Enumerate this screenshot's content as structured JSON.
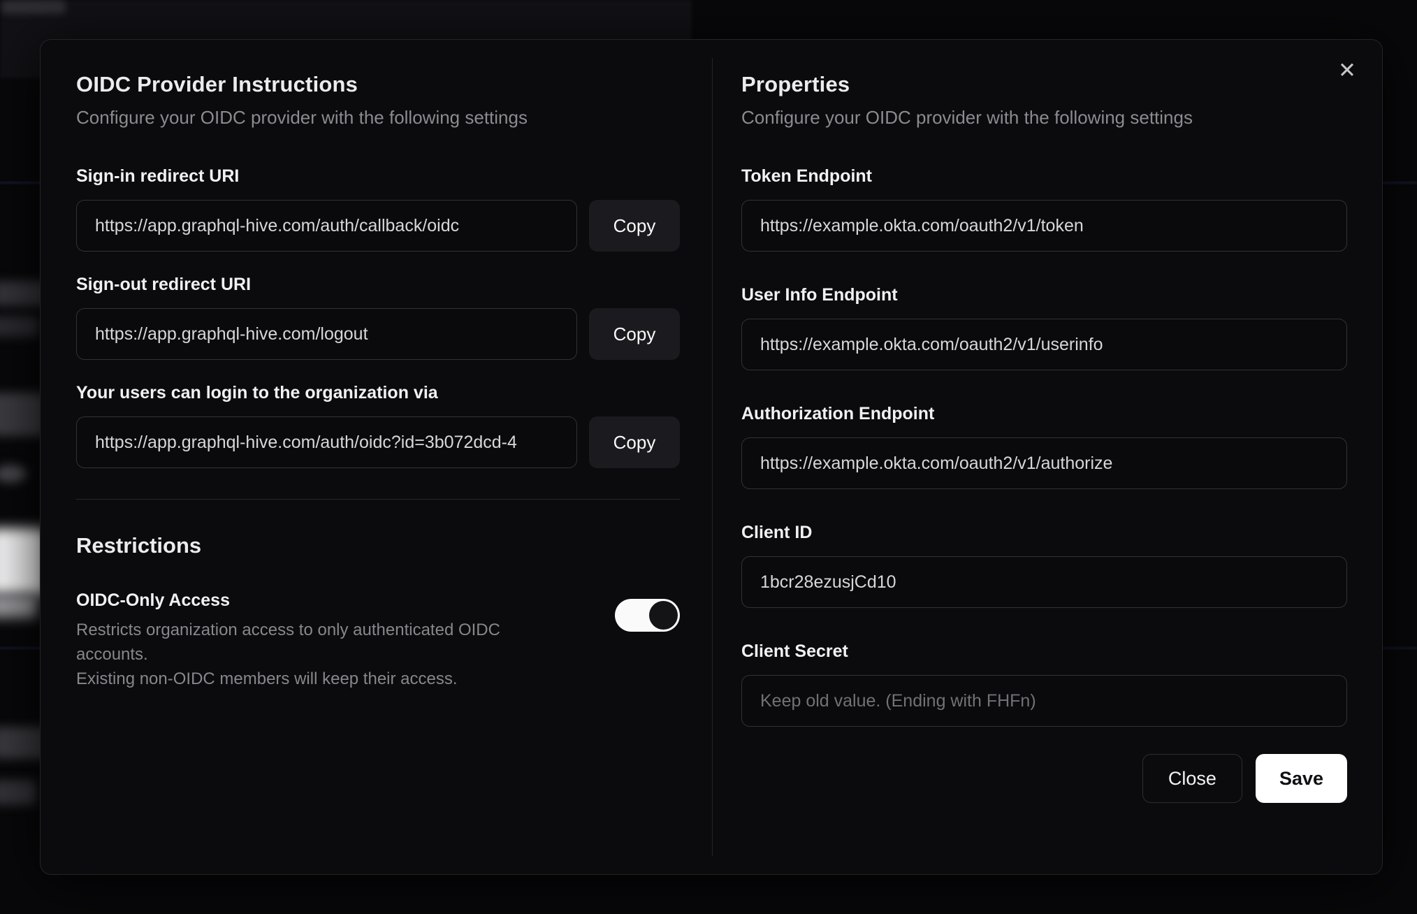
{
  "colors": {
    "page_bg": "#08080a",
    "modal_bg": "#0b0b0d",
    "input_border": "#323234",
    "copy_button_bg": "#1b1b1f",
    "save_button_bg": "#ffffff",
    "toggle_on_track": "#fafafa",
    "toggle_knob": "#141417",
    "muted_text": "#8b8b90",
    "title_text": "#ececee"
  },
  "modal": {
    "close_icon": "✕",
    "left": {
      "title": "OIDC Provider Instructions",
      "subtitle": "Configure your OIDC provider with the following settings",
      "fields": [
        {
          "label": "Sign-in redirect URI",
          "value": "https://app.graphql-hive.com/auth/callback/oidc",
          "button": "Copy"
        },
        {
          "label": "Sign-out redirect URI",
          "value": "https://app.graphql-hive.com/logout",
          "button": "Copy"
        },
        {
          "label": "Your users can login to the organization via",
          "value": "https://app.graphql-hive.com/auth/oidc?id=3b072dcd-4",
          "button": "Copy"
        }
      ],
      "restrictions": {
        "title": "Restrictions",
        "toggle_label": "OIDC-Only Access",
        "description_line1": "Restricts organization access to only authenticated OIDC accounts.",
        "description_line2": "Existing non-OIDC members will keep their access.",
        "toggle_state": "on"
      }
    },
    "right": {
      "title": "Properties",
      "subtitle": "Configure your OIDC provider with the following settings",
      "fields": [
        {
          "label": "Token Endpoint",
          "value": "https://example.okta.com/oauth2/v1/token"
        },
        {
          "label": "User Info Endpoint",
          "value": "https://example.okta.com/oauth2/v1/userinfo"
        },
        {
          "label": "Authorization Endpoint",
          "value": "https://example.okta.com/oauth2/v1/authorize"
        },
        {
          "label": "Client ID",
          "value": "1bcr28ezusjCd10"
        },
        {
          "label": "Client Secret",
          "value": "",
          "placeholder": "Keep old value. (Ending with FHFn)"
        }
      ],
      "buttons": {
        "close": "Close",
        "save": "Save"
      }
    }
  }
}
